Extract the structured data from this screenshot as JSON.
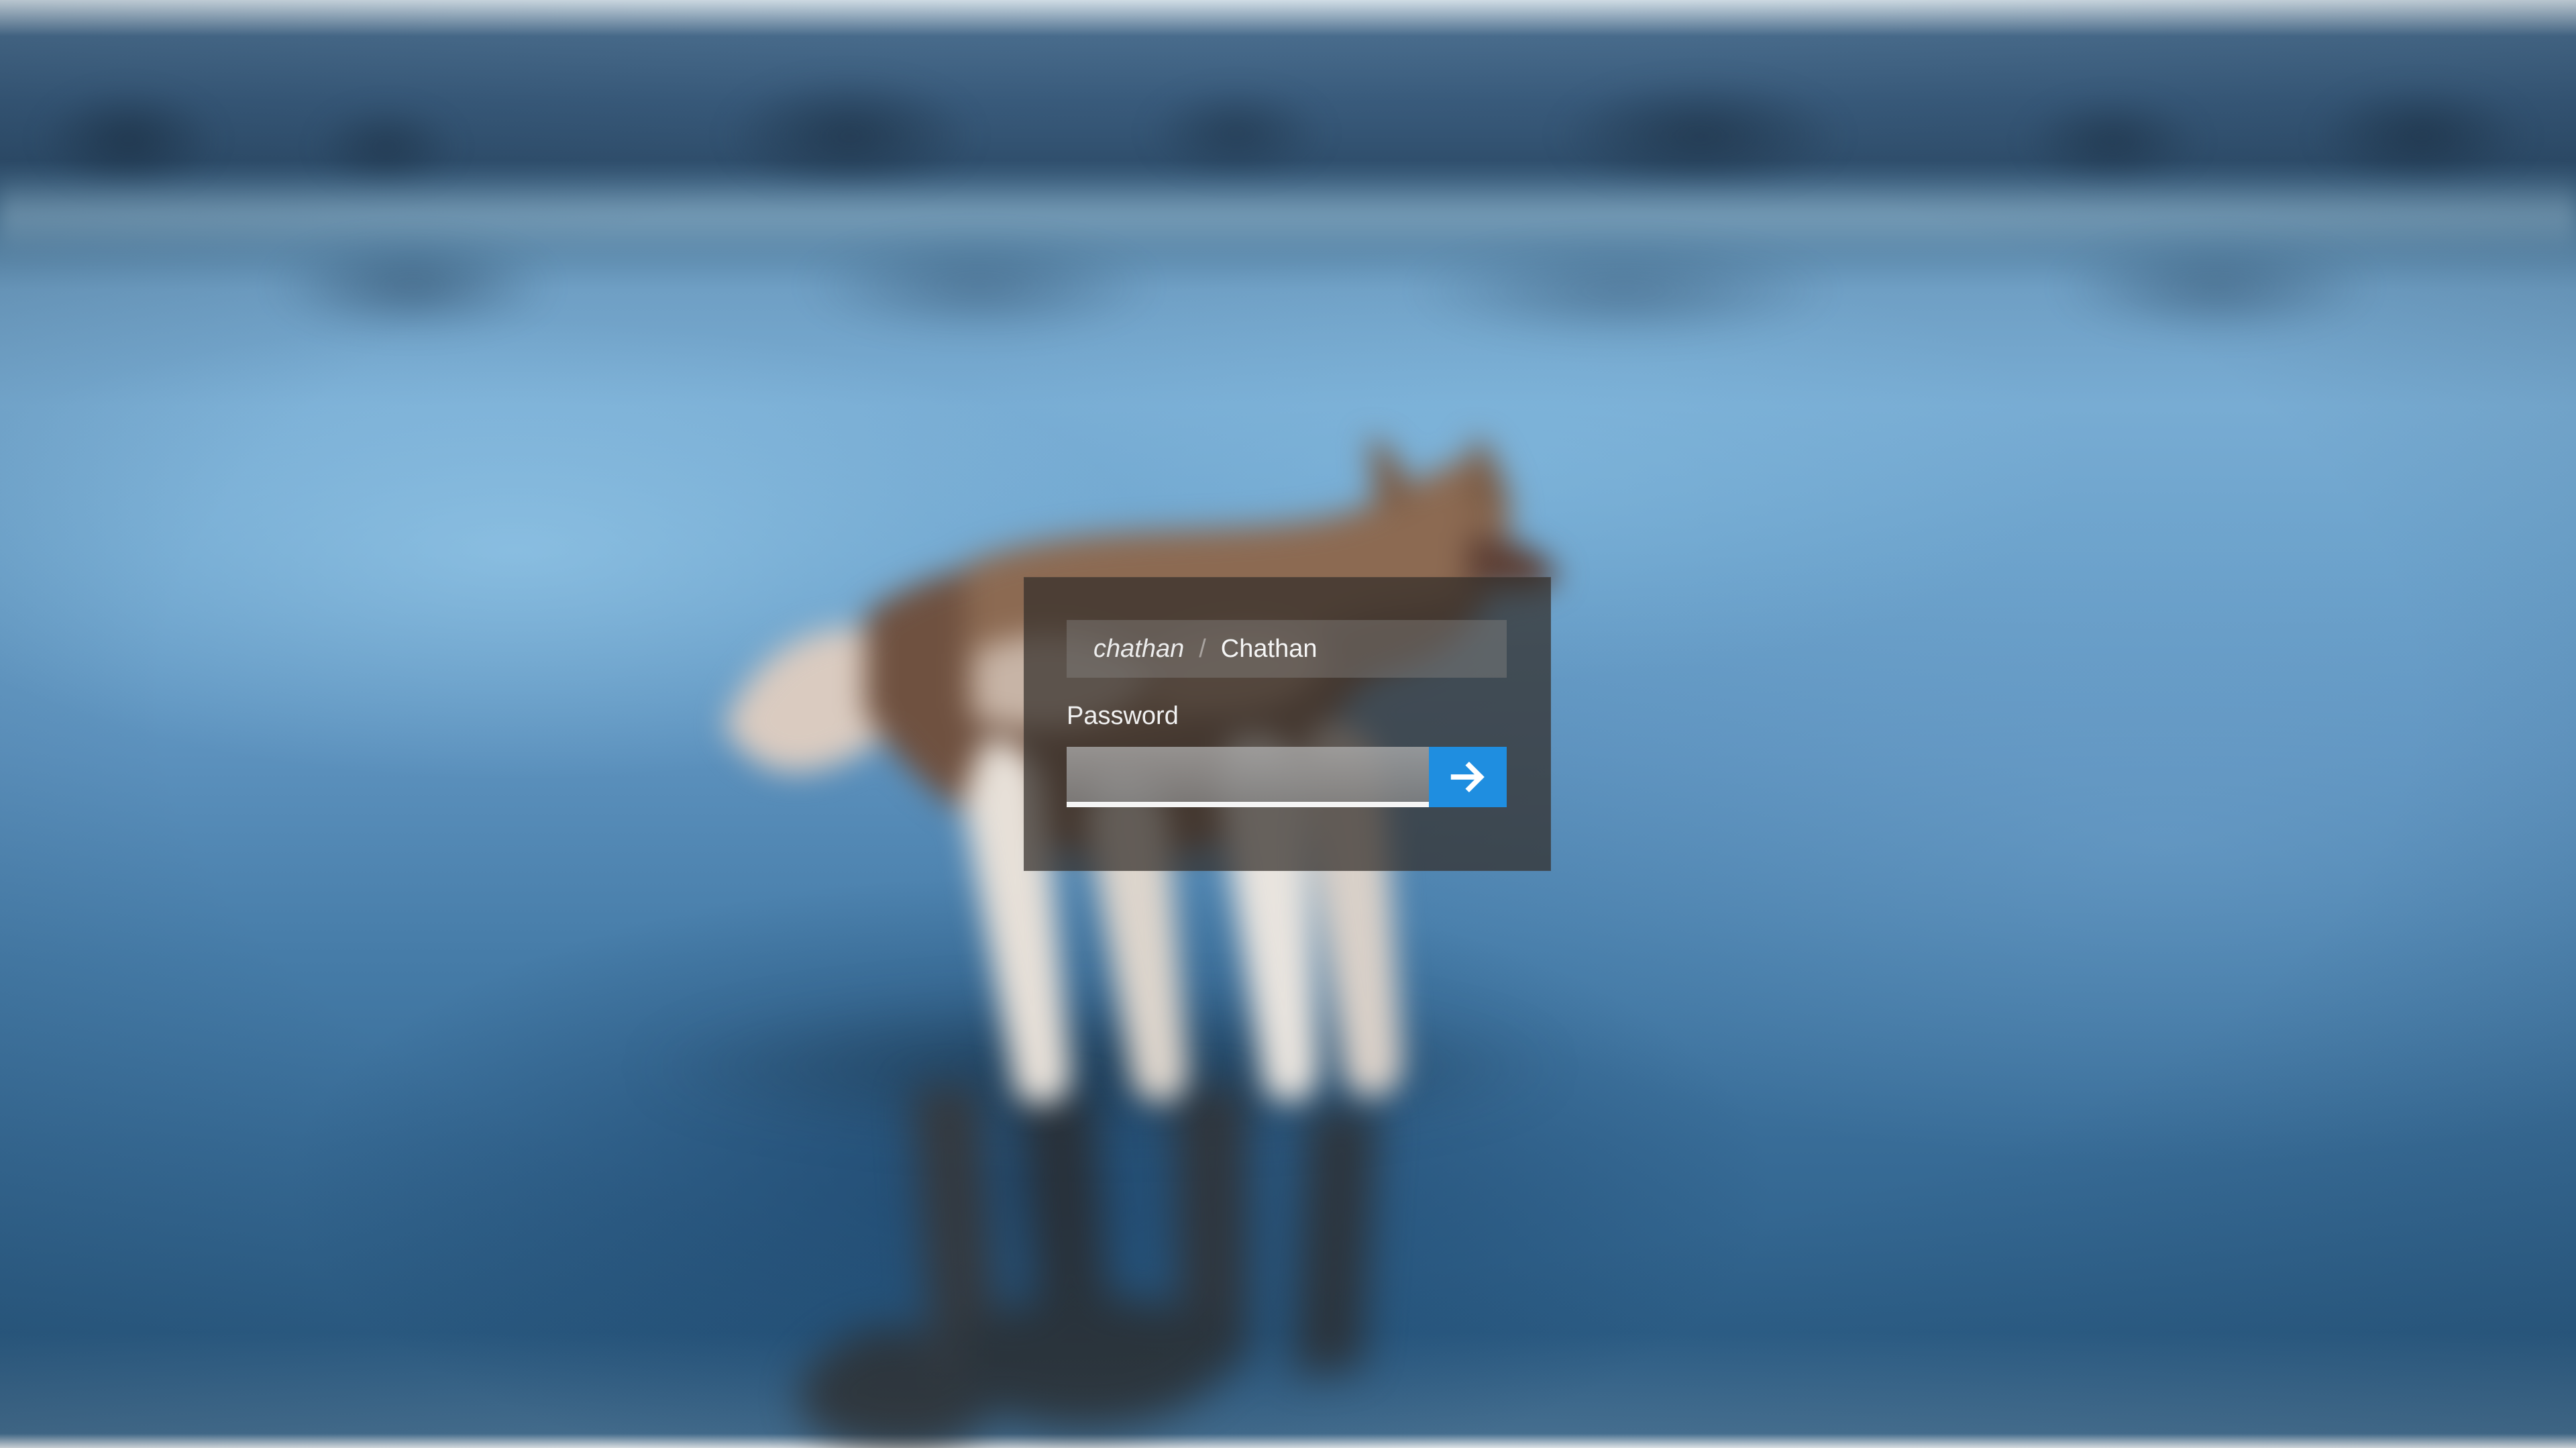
{
  "login": {
    "username": "chathan",
    "separator": "/",
    "display_name": "Chathan",
    "password_label": "Password",
    "password_value": ""
  },
  "icons": {
    "submit": "arrow-right-icon"
  },
  "colors": {
    "panel_background": "#332e2a",
    "submit_button": "#1f8ee0",
    "text": "#f1f1f1",
    "background_blue": "#5c91bd"
  }
}
